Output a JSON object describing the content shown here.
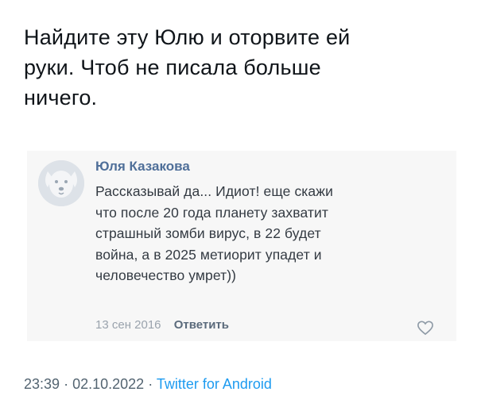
{
  "tweet": {
    "text_lines": [
      "Найдите эту Юлю и оторвите ей",
      "руки. Чтоб не писала больше",
      "ничего."
    ],
    "time": "23:39",
    "separator": "·",
    "date": "02.10.2022",
    "source": "Twitter for Android",
    "colors": {
      "text": "#0f1419",
      "meta": "#536471",
      "link": "#1d9bf0"
    }
  },
  "comment": {
    "author": "Юля Казакова",
    "text_lines": [
      "Рассказывай да... Идиот! еще скажи",
      "что после 20 года планету захватит",
      "страшный зомби вирус, в 22 будет",
      "война, а в 2025 метиорит упадет и",
      "человечество умрет))"
    ],
    "date": "13 сен 2016",
    "reply_label": "Ответить",
    "avatar_icon": "dog-avatar-icon",
    "like_icon": "heart-icon",
    "colors": {
      "author": "#4f6f99",
      "text": "#333a42",
      "meta": "#9aa3ad"
    }
  }
}
